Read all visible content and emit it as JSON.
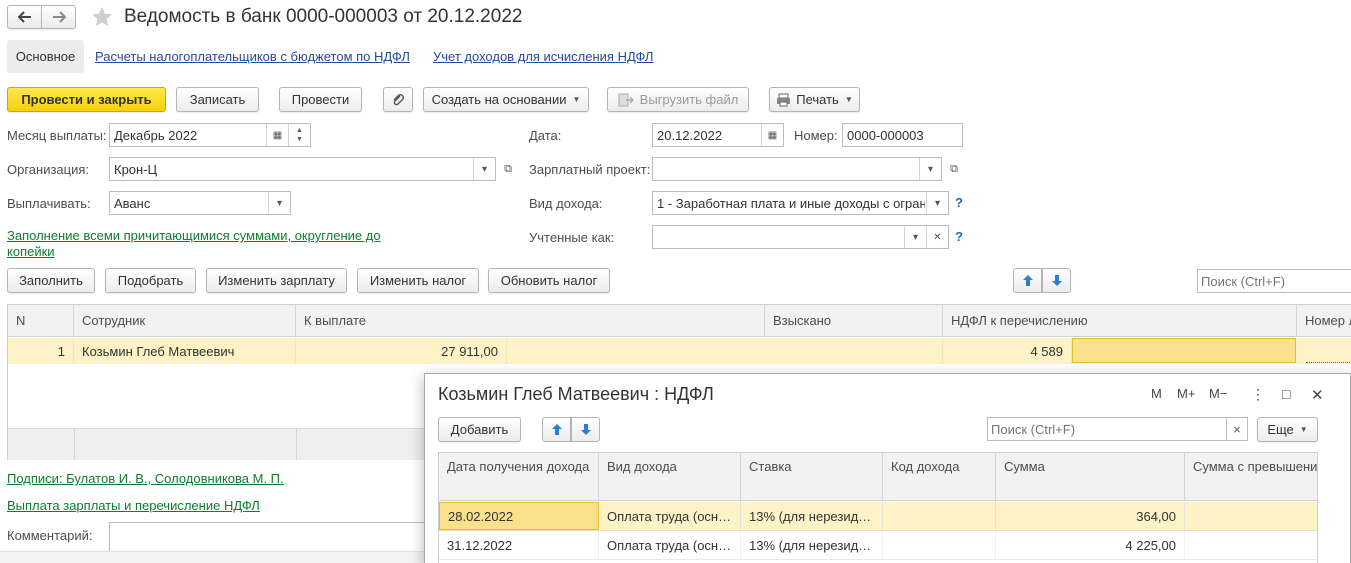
{
  "title": "Ведомость в банк 0000-000003 от 20.12.2022",
  "nav": {
    "back_icon": "arrow-left-icon",
    "forward_icon": "arrow-right-icon",
    "favorite_icon": "star-icon"
  },
  "tabs": [
    "Основное",
    "Расчеты налогоплательщиков с бюджетом по НДФЛ",
    "Учет доходов для исчисления НДФЛ"
  ],
  "toolbar": {
    "post_close": "Провести и закрыть",
    "save": "Записать",
    "post": "Провести",
    "create_based": "Создать на основании",
    "export_file": "Выгрузить файл",
    "print": "Печать"
  },
  "form": {
    "month_label": "Месяц выплаты:",
    "month_value": "Декабрь 2022",
    "org_label": "Организация:",
    "org_value": "Крон-Ц",
    "pay_label": "Выплачивать:",
    "pay_value": "Аванс",
    "date_label": "Дата:",
    "date_value": "20.12.2022",
    "number_label": "Номер:",
    "number_value": "0000-000003",
    "salary_project_label": "Зарплатный проект:",
    "salary_project_value": "",
    "income_type_label": "Вид дохода:",
    "income_type_value": "1 - Заработная плата и иные доходы с огран",
    "accounted_as_label": "Учтенные как:",
    "accounted_as_value": "",
    "help": "?",
    "fill_link_line1": "Заполнение всеми причитающимися суммами, округление до",
    "fill_link_line2": "копейки"
  },
  "table_toolbar": {
    "fill": "Заполнить",
    "pick": "Подобрать",
    "change_salary": "Изменить зарплату",
    "change_tax": "Изменить налог",
    "update_tax": "Обновить налог",
    "search_placeholder": "Поиск (Ctrl+F)"
  },
  "main_table": {
    "columns": [
      "N",
      "Сотрудник",
      "К выплате",
      "Взыскано",
      "НДФЛ к перечислению",
      "Номер л"
    ],
    "rows": [
      {
        "n": "1",
        "employee": "Козьмин Глеб Матвеевич",
        "to_pay": "27 911,00",
        "recovered": "",
        "ndfl": "4 589"
      }
    ]
  },
  "footer": {
    "signatures": "Подписи: Булатов И. В., Солодовникова М. П.",
    "payment_link": "Выплата зарплаты и перечисление НДФЛ",
    "comment_label": "Комментарий:"
  },
  "popup": {
    "title": "Козьмин Глеб Матвеевич : НДФЛ",
    "controls": [
      "M",
      "M+",
      "M−",
      "⋮",
      "□",
      "✕"
    ],
    "add": "Добавить",
    "search_placeholder": "Поиск (Ctrl+F)",
    "clear": "×",
    "more": "Еще",
    "columns": [
      "Дата получения дохода",
      "Вид дохода",
      "Ставка",
      "Код дохода",
      "Сумма",
      "Сумма с превышени"
    ],
    "rows": [
      {
        "date": "28.02.2022",
        "type": "Оплата труда (осн…",
        "rate": "13% (для нерезид…",
        "code": "",
        "amount": "364,00"
      },
      {
        "date": "31.12.2022",
        "type": "Оплата труда (осн…",
        "rate": "13% (для нерезид…",
        "code": "",
        "amount": "4 225,00"
      }
    ]
  },
  "colors": {
    "primary_button": "#f5d108",
    "selected_row": "#fdf3c6",
    "link": "#1c4f97",
    "green_link": "#0d7d2f"
  }
}
